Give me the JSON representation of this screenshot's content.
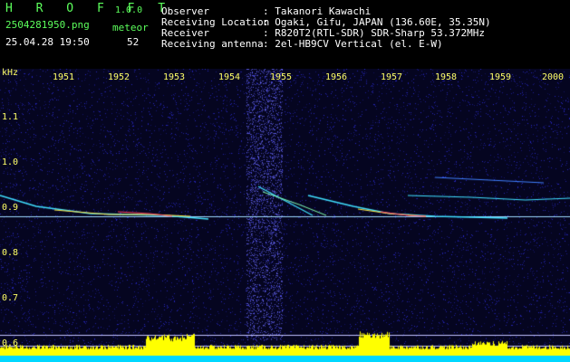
{
  "app": {
    "logo": "H R O F F T",
    "version": "1.0.0",
    "filename": "2504281950.png",
    "mode": "meteor",
    "datetime": "25.04.28 19:50",
    "count": "52"
  },
  "info": {
    "observer_label": "Observer",
    "observer_value": ": Takanori Kawachi",
    "location_label": "Receiving Location",
    "location_value": ": Ogaki, Gifu, JAPAN (136.60E, 35.35N)",
    "receiver_label": "Receiver",
    "receiver_value": ": R820T2(RTL-SDR) SDR-Sharp 53.372MHz",
    "antenna_label": "Receiving antenna",
    "antenna_value": ": 2el-HB9CV Vertical (el. E-W)"
  },
  "axis": {
    "y_unit": "kHz",
    "y_ticks": [
      "1.1",
      "1.0",
      "0.9",
      "0.8",
      "0.7",
      "0.6"
    ],
    "x_ticks": [
      "1951",
      "1952",
      "1953",
      "1954",
      "1955",
      "1956",
      "1957",
      "1958",
      "1959",
      "2000"
    ]
  },
  "colors": {
    "background": "#000000",
    "noise": "#1a1aa0",
    "label_green": "#5cff5c",
    "tick_yellow": "#ffff66",
    "activity_yellow": "#ffff00",
    "activity_cyan": "#00e5ff"
  }
}
